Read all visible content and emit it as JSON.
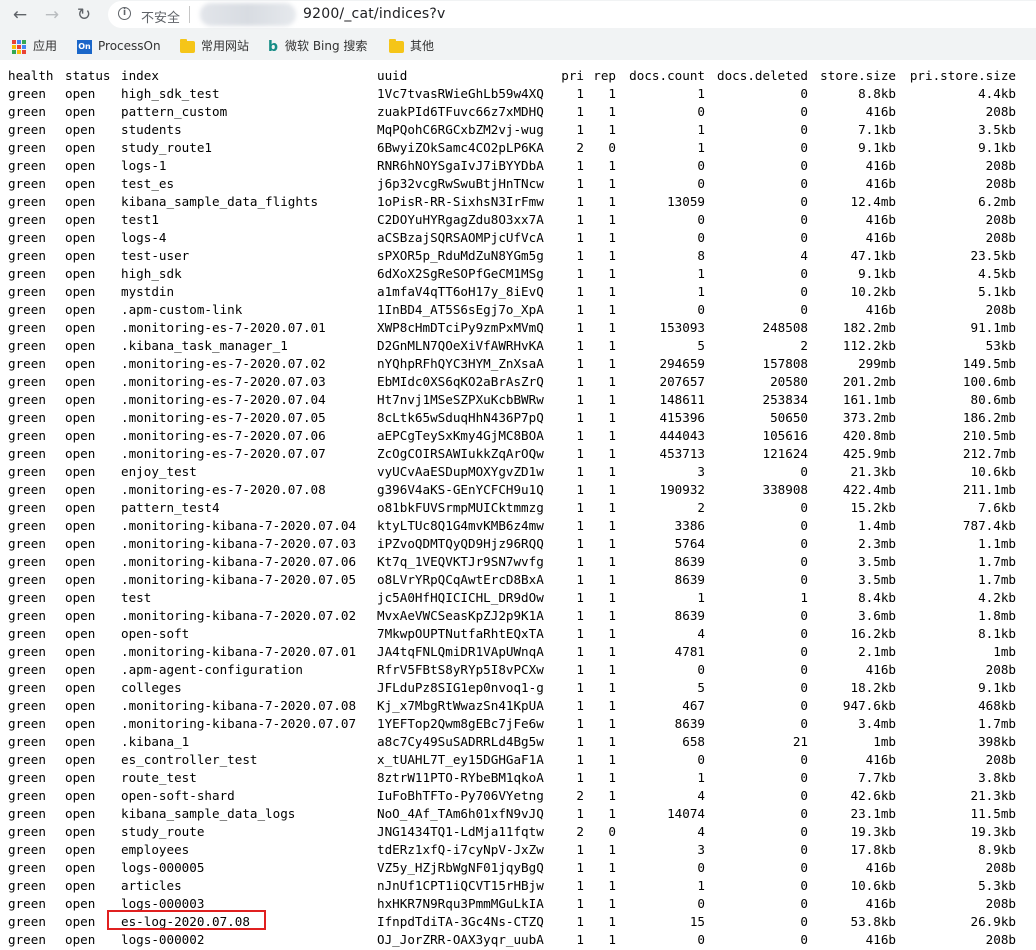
{
  "browser": {
    "security_label": "不安全",
    "url": "9200/_cat/indices?v",
    "bookmarks": [
      {
        "label": "应用",
        "icon": "apps-icon"
      },
      {
        "label": "ProcessOn",
        "icon": "processon-icon"
      },
      {
        "label": "常用网站",
        "icon": "folder-icon"
      },
      {
        "label": "微软 Bing 搜索",
        "icon": "bing-icon"
      },
      {
        "label": "其他",
        "icon": "folder-icon"
      }
    ]
  },
  "table": {
    "headers": [
      "health",
      "status",
      "index",
      "uuid",
      "pri",
      "rep",
      "docs.count",
      "docs.deleted",
      "store.size",
      "pri.store.size"
    ],
    "rows": [
      [
        "green",
        "open",
        "high_sdk_test",
        "1Vc7tvasRWieGhLb59w4XQ",
        "1",
        "1",
        "1",
        "0",
        "8.8kb",
        "4.4kb"
      ],
      [
        "green",
        "open",
        "pattern_custom",
        "zuakPId6TFuvc66z7xMDHQ",
        "1",
        "1",
        "0",
        "0",
        "416b",
        "208b"
      ],
      [
        "green",
        "open",
        "students",
        "MqPQohC6RGCxbZM2vj-wug",
        "1",
        "1",
        "1",
        "0",
        "7.1kb",
        "3.5kb"
      ],
      [
        "green",
        "open",
        "study_route1",
        "6BwyiZOkSamc4CO2pLP6KA",
        "2",
        "0",
        "1",
        "0",
        "9.1kb",
        "9.1kb"
      ],
      [
        "green",
        "open",
        "logs-1",
        "RNR6hNOYSgaIvJ7iBYYDbA",
        "1",
        "1",
        "0",
        "0",
        "416b",
        "208b"
      ],
      [
        "green",
        "open",
        "test_es",
        "j6p32vcgRwSwuBtjHnTNcw",
        "1",
        "1",
        "0",
        "0",
        "416b",
        "208b"
      ],
      [
        "green",
        "open",
        "kibana_sample_data_flights",
        "1oPisR-RR-SixhsN3IrFmw",
        "1",
        "1",
        "13059",
        "0",
        "12.4mb",
        "6.2mb"
      ],
      [
        "green",
        "open",
        "test1",
        "C2DOYuHYRgagZdu8O3xx7A",
        "1",
        "1",
        "0",
        "0",
        "416b",
        "208b"
      ],
      [
        "green",
        "open",
        "logs-4",
        "aCSBzajSQRSAOMPjcUfVcA",
        "1",
        "1",
        "0",
        "0",
        "416b",
        "208b"
      ],
      [
        "green",
        "open",
        "test-user",
        "sPXOR5p_RduMdZuN8YGm5g",
        "1",
        "1",
        "8",
        "4",
        "47.1kb",
        "23.5kb"
      ],
      [
        "green",
        "open",
        "high_sdk",
        "6dXoX2SgReSOPfGeCM1MSg",
        "1",
        "1",
        "1",
        "0",
        "9.1kb",
        "4.5kb"
      ],
      [
        "green",
        "open",
        "mystdin",
        "a1mfaV4qTT6oH17y_8iEvQ",
        "1",
        "1",
        "1",
        "0",
        "10.2kb",
        "5.1kb"
      ],
      [
        "green",
        "open",
        ".apm-custom-link",
        "1InBD4_AT5S6sEgj7o_XpA",
        "1",
        "1",
        "0",
        "0",
        "416b",
        "208b"
      ],
      [
        "green",
        "open",
        ".monitoring-es-7-2020.07.01",
        "XWP8cHmDTciPy9zmPxMVmQ",
        "1",
        "1",
        "153093",
        "248508",
        "182.2mb",
        "91.1mb"
      ],
      [
        "green",
        "open",
        ".kibana_task_manager_1",
        "D2GnMLN7QOeXiVfAWRHvKA",
        "1",
        "1",
        "5",
        "2",
        "112.2kb",
        "53kb"
      ],
      [
        "green",
        "open",
        ".monitoring-es-7-2020.07.02",
        "nYQhpRFhQYC3HYM_ZnXsaA",
        "1",
        "1",
        "294659",
        "157808",
        "299mb",
        "149.5mb"
      ],
      [
        "green",
        "open",
        ".monitoring-es-7-2020.07.03",
        "EbMIdc0XS6qKO2aBrAsZrQ",
        "1",
        "1",
        "207657",
        "20580",
        "201.2mb",
        "100.6mb"
      ],
      [
        "green",
        "open",
        ".monitoring-es-7-2020.07.04",
        "Ht7nvj1MSeSZPXuKcbBWRw",
        "1",
        "1",
        "148611",
        "253834",
        "161.1mb",
        "80.6mb"
      ],
      [
        "green",
        "open",
        ".monitoring-es-7-2020.07.05",
        "8cLtk65wSduqHhN436P7pQ",
        "1",
        "1",
        "415396",
        "50650",
        "373.2mb",
        "186.2mb"
      ],
      [
        "green",
        "open",
        ".monitoring-es-7-2020.07.06",
        "aEPCgTeySxKmy4GjMC8BOA",
        "1",
        "1",
        "444043",
        "105616",
        "420.8mb",
        "210.5mb"
      ],
      [
        "green",
        "open",
        ".monitoring-es-7-2020.07.07",
        "ZcOgCOIRSAWIukkZqArOQw",
        "1",
        "1",
        "453713",
        "121624",
        "425.9mb",
        "212.7mb"
      ],
      [
        "green",
        "open",
        "enjoy_test",
        "vyUCvAaESDupMOXYgvZD1w",
        "1",
        "1",
        "3",
        "0",
        "21.3kb",
        "10.6kb"
      ],
      [
        "green",
        "open",
        ".monitoring-es-7-2020.07.08",
        "g396V4aKS-GEnYCFCH9u1Q",
        "1",
        "1",
        "190932",
        "338908",
        "422.4mb",
        "211.1mb"
      ],
      [
        "green",
        "open",
        "pattern_test4",
        "o81bkFUVSrmpMUICktmmzg",
        "1",
        "1",
        "2",
        "0",
        "15.2kb",
        "7.6kb"
      ],
      [
        "green",
        "open",
        ".monitoring-kibana-7-2020.07.04",
        "ktyLTUc8Q1G4mvKMB6z4mw",
        "1",
        "1",
        "3386",
        "0",
        "1.4mb",
        "787.4kb"
      ],
      [
        "green",
        "open",
        ".monitoring-kibana-7-2020.07.03",
        "iPZvoQDMTQyQD9Hjz96RQQ",
        "1",
        "1",
        "5764",
        "0",
        "2.3mb",
        "1.1mb"
      ],
      [
        "green",
        "open",
        ".monitoring-kibana-7-2020.07.06",
        "Kt7q_1VEQVKTJr9SN7wvfg",
        "1",
        "1",
        "8639",
        "0",
        "3.5mb",
        "1.7mb"
      ],
      [
        "green",
        "open",
        ".monitoring-kibana-7-2020.07.05",
        "o8LVrYRpQCqAwtErcD8BxA",
        "1",
        "1",
        "8639",
        "0",
        "3.5mb",
        "1.7mb"
      ],
      [
        "green",
        "open",
        "test",
        "jc5A0HfHQICICHL_DR9dOw",
        "1",
        "1",
        "1",
        "1",
        "8.4kb",
        "4.2kb"
      ],
      [
        "green",
        "open",
        ".monitoring-kibana-7-2020.07.02",
        "MvxAeVWCSeasKpZJ2p9K1A",
        "1",
        "1",
        "8639",
        "0",
        "3.6mb",
        "1.8mb"
      ],
      [
        "green",
        "open",
        "open-soft",
        "7MkwpOUPTNutfaRhtEQxTA",
        "1",
        "1",
        "4",
        "0",
        "16.2kb",
        "8.1kb"
      ],
      [
        "green",
        "open",
        ".monitoring-kibana-7-2020.07.01",
        "JA4tqFNLQmiDR1VApUWnqA",
        "1",
        "1",
        "4781",
        "0",
        "2.1mb",
        "1mb"
      ],
      [
        "green",
        "open",
        ".apm-agent-configuration",
        "RfrV5FBtS8yRYp5I8vPCXw",
        "1",
        "1",
        "0",
        "0",
        "416b",
        "208b"
      ],
      [
        "green",
        "open",
        "colleges",
        "JFLduPz8SIG1ep0nvoq1-g",
        "1",
        "1",
        "5",
        "0",
        "18.2kb",
        "9.1kb"
      ],
      [
        "green",
        "open",
        ".monitoring-kibana-7-2020.07.08",
        "Kj_x7MbgRtWwazSn41KpUA",
        "1",
        "1",
        "467",
        "0",
        "947.6kb",
        "468kb"
      ],
      [
        "green",
        "open",
        ".monitoring-kibana-7-2020.07.07",
        "1YEFTop2Qwm8gEBc7jFe6w",
        "1",
        "1",
        "8639",
        "0",
        "3.4mb",
        "1.7mb"
      ],
      [
        "green",
        "open",
        ".kibana_1",
        "a8c7Cy49SuSADRRLd4Bg5w",
        "1",
        "1",
        "658",
        "21",
        "1mb",
        "398kb"
      ],
      [
        "green",
        "open",
        "es_controller_test",
        "x_tUAHL7T_ey15DGHGaF1A",
        "1",
        "1",
        "0",
        "0",
        "416b",
        "208b"
      ],
      [
        "green",
        "open",
        "route_test",
        "8ztrW11PTO-RYbeBM1qkoA",
        "1",
        "1",
        "1",
        "0",
        "7.7kb",
        "3.8kb"
      ],
      [
        "green",
        "open",
        "open-soft-shard",
        "IuFoBhTFTo-Py706VYetng",
        "2",
        "1",
        "4",
        "0",
        "42.6kb",
        "21.3kb"
      ],
      [
        "green",
        "open",
        "kibana_sample_data_logs",
        "NoO_4Af_TAm6h01xfN9vJQ",
        "1",
        "1",
        "14074",
        "0",
        "23.1mb",
        "11.5mb"
      ],
      [
        "green",
        "open",
        "study_route",
        "JNG1434TQ1-LdMja11fqtw",
        "2",
        "0",
        "4",
        "0",
        "19.3kb",
        "19.3kb"
      ],
      [
        "green",
        "open",
        "employees",
        "tdERz1xfQ-i7cyNpV-JxZw",
        "1",
        "1",
        "3",
        "0",
        "17.8kb",
        "8.9kb"
      ],
      [
        "green",
        "open",
        "logs-000005",
        "VZ5y_HZjRbWgNF01jqyBgQ",
        "1",
        "1",
        "0",
        "0",
        "416b",
        "208b"
      ],
      [
        "green",
        "open",
        "articles",
        "nJnUf1CPT1iQCVT15rHBjw",
        "1",
        "1",
        "1",
        "0",
        "10.6kb",
        "5.3kb"
      ],
      [
        "green",
        "open",
        "logs-000003",
        "hxHKR7N9Rqu3PmmMGuLkIA",
        "1",
        "1",
        "0",
        "0",
        "416b",
        "208b"
      ],
      [
        "green",
        "open",
        "es-log-2020.07.08",
        "IfnpdTdiTA-3Gc4Ns-CTZQ",
        "1",
        "1",
        "15",
        "0",
        "53.8kb",
        "26.9kb"
      ],
      [
        "green",
        "open",
        "logs-000002",
        "OJ_JorZRR-OAX3yqr_uubA",
        "1",
        "1",
        "0",
        "0",
        "416b",
        "208b"
      ]
    ],
    "highlighted_row_index": 46
  }
}
